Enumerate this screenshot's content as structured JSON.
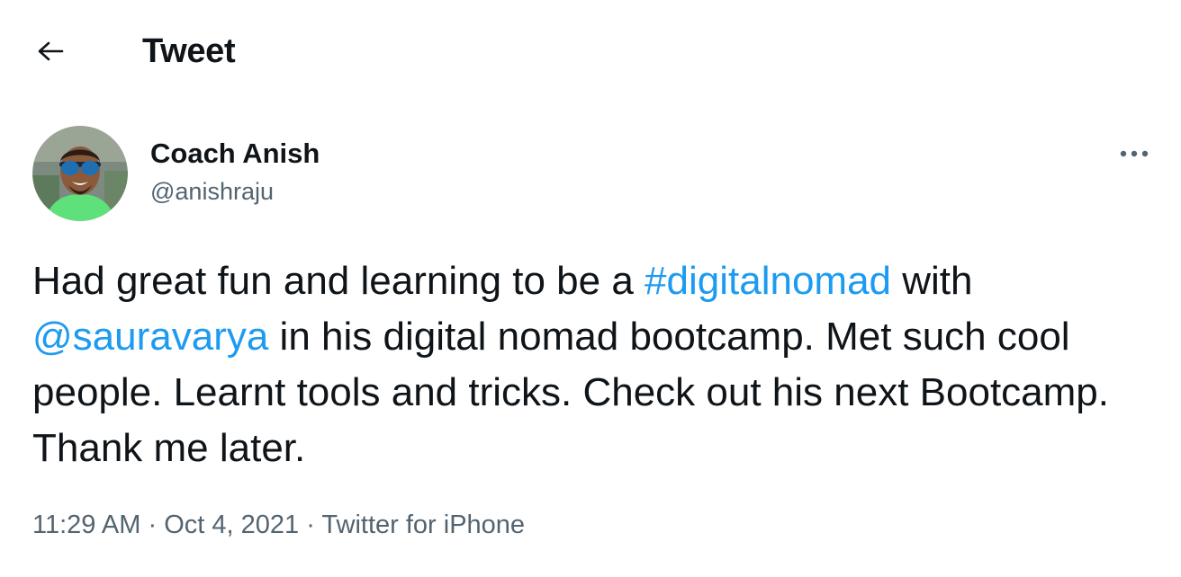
{
  "header": {
    "title": "Tweet",
    "back_icon": "arrow-left-icon"
  },
  "author": {
    "name": "Coach Anish",
    "handle": "@anishraju",
    "more_icon": "more-horizontal-icon"
  },
  "tweet": {
    "segments": [
      {
        "text": "Had great fun and learning to be a ",
        "type": "text"
      },
      {
        "text": "#digitalnomad",
        "type": "hashtag"
      },
      {
        "text": " with ",
        "type": "text"
      },
      {
        "text": "@sauravarya",
        "type": "mention"
      },
      {
        "text": " in his digital nomad bootcamp. Met such cool people. Learnt tools and tricks. Check out his next Bootcamp. Thank me later.",
        "type": "text"
      }
    ]
  },
  "meta": {
    "time": "11:29 AM",
    "separator": "·",
    "date": "Oct 4, 2021",
    "source": "Twitter for iPhone"
  },
  "colors": {
    "link": "#1d9bf0",
    "secondary_text": "#536471",
    "primary_text": "#0f1419"
  }
}
